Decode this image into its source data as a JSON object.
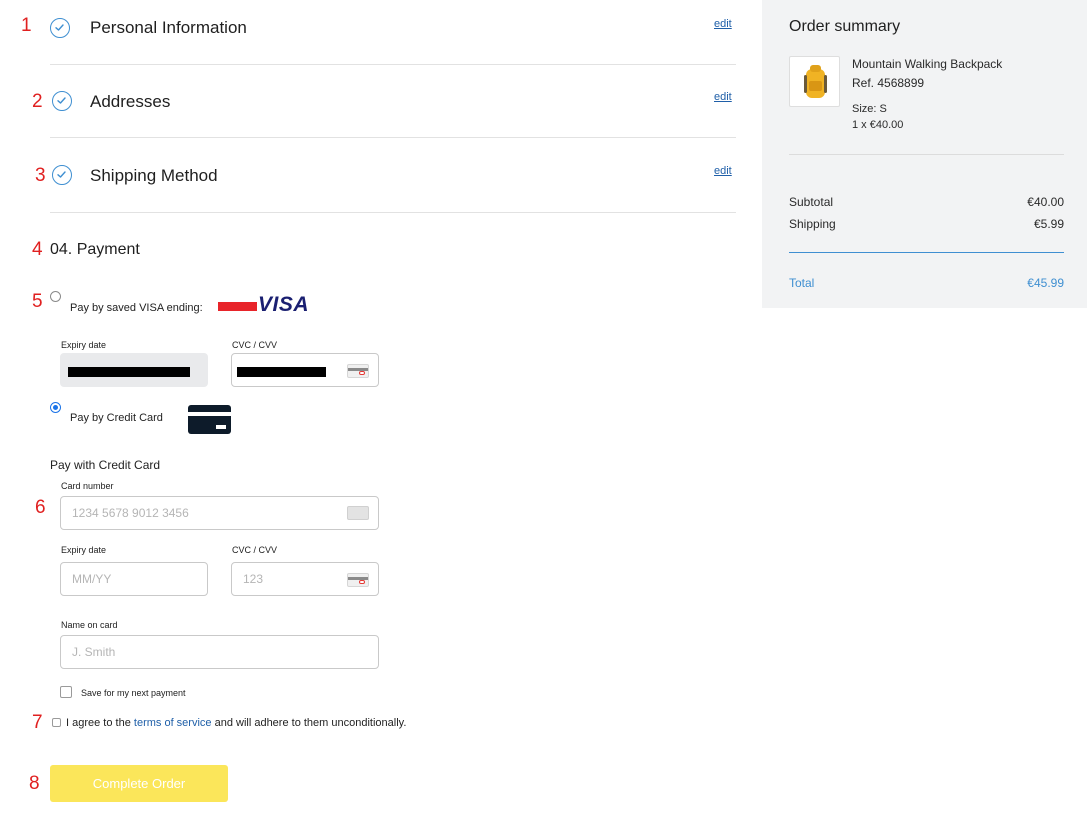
{
  "annotations": [
    "1",
    "2",
    "3",
    "4",
    "5",
    "6",
    "7",
    "8"
  ],
  "steps": [
    {
      "title": "Personal Information",
      "edit": "edit"
    },
    {
      "title": "Addresses",
      "edit": "edit"
    },
    {
      "title": "Shipping Method",
      "edit": "edit"
    }
  ],
  "payment": {
    "heading": "04. Payment",
    "saved_card": {
      "label": "Pay by saved VISA ending:",
      "brand": "VISA",
      "expiry_label": "Expiry date",
      "cvc_label": "CVC / CVV",
      "selected": false
    },
    "credit_card_option": {
      "label": "Pay by Credit Card",
      "selected": true
    },
    "form": {
      "title": "Pay with Credit Card",
      "card_number_label": "Card number",
      "card_number_placeholder": "1234 5678 9012 3456",
      "expiry_label": "Expiry date",
      "expiry_placeholder": "MM/YY",
      "cvc_label": "CVC / CVV",
      "cvc_placeholder": "123",
      "name_label": "Name on card",
      "name_placeholder": "J. Smith",
      "save_label": "Save for my next payment"
    },
    "terms": {
      "prefix": "I agree to the ",
      "link": "terms of service",
      "suffix": " and will adhere to them unconditionally."
    },
    "complete_button": "Complete Order"
  },
  "summary": {
    "title": "Order summary",
    "item": {
      "name": "Mountain Walking Backpack",
      "ref": "Ref. 4568899",
      "size": "Size: S",
      "qty_price": "1 x €40.00"
    },
    "subtotal_label": "Subtotal",
    "subtotal_value": "€40.00",
    "shipping_label": "Shipping",
    "shipping_value": "€5.99",
    "total_label": "Total",
    "total_value": "€45.99"
  },
  "colors": {
    "accent_blue": "#3f8fd1",
    "link_blue": "#1f5fa8",
    "visa_blue": "#1a1f71",
    "button_yellow": "#fbe65a",
    "annotation_red": "#e02020"
  },
  "icons": [
    "check-circle-icon",
    "visa-logo-icon",
    "credit-card-icon",
    "card-cvc-icon",
    "card-icon",
    "backpack-icon"
  ]
}
